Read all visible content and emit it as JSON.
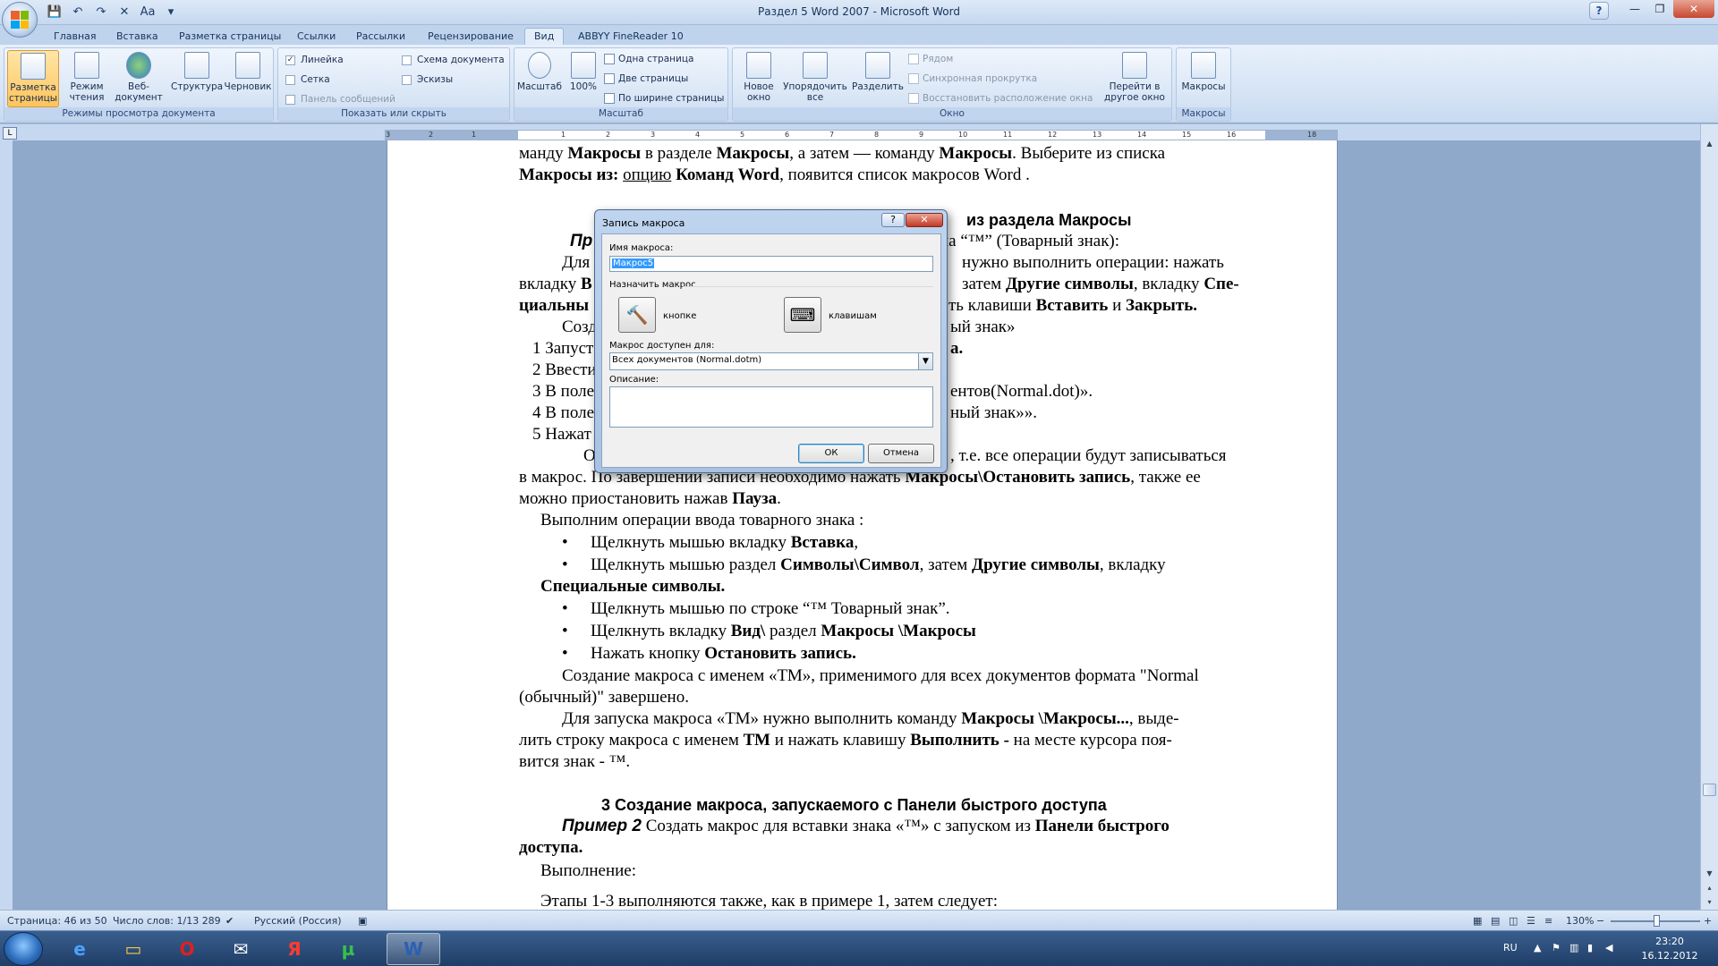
{
  "window": {
    "title": "Раздел 5 Word 2007 - Microsoft Word",
    "help_label": "?"
  },
  "tabs": [
    "Главная",
    "Вставка",
    "Разметка страницы",
    "Ссылки",
    "Рассылки",
    "Рецензирование",
    "Вид",
    "ABBYY FineReader 10"
  ],
  "active_tab": "Вид",
  "ribbon": {
    "views_group": {
      "label": "Режимы просмотра документа",
      "buttons": [
        "Разметка страницы",
        "Режим чтения",
        "Веб-документ",
        "Структура",
        "Черновик"
      ]
    },
    "show_group": {
      "label": "Показать или скрыть",
      "ruler": "Линейка",
      "grid": "Сетка",
      "message_bar": "Панель сообщений",
      "doc_map": "Схема документа",
      "thumbnails": "Эскизы"
    },
    "zoom_group": {
      "label": "Масштаб",
      "zoom": "Масштаб",
      "hundred": "100%",
      "one_page": "Одна страница",
      "two_pages": "Две страницы",
      "page_width": "По ширине страницы"
    },
    "window_group": {
      "label": "Окно",
      "new_window": "Новое окно",
      "arrange_all": "Упорядочить все",
      "split": "Разделить",
      "side_by_side": "Рядом",
      "sync_scroll": "Синхронная прокрутка",
      "reset_pos": "Восстановить расположение окна",
      "switch": "Перейти в другое окно"
    },
    "macros_group": {
      "label": "Макросы",
      "macros": "Макросы"
    }
  },
  "ruler_numbers": [
    "3",
    "2",
    "1",
    "1",
    "2",
    "3",
    "4",
    "5",
    "6",
    "7",
    "8",
    "9",
    "10",
    "11",
    "12",
    "13",
    "14",
    "15",
    "16",
    "18"
  ],
  "document": {
    "l1": "манду",
    "l1b": "Макросы",
    "l1c": "в разделе",
    "l1d": "Макросы",
    "l1e": ", а затем — команду",
    "l1f": "Макросы",
    "l1g": ". Выберите из списка",
    "l2a": "Макросы из:",
    "l2b": "опцию",
    "l2c": "Команд Word",
    "l2d": ", появится  список макросов Word .",
    "h1": "из раздела Макросы",
    "l3": "па “™” (Товарный знак):",
    "l4a": "Для",
    "l4b": "нужно выполнить операции: нажать",
    "l5a": "вкладку",
    "l5b": "В",
    "l5c": "затем",
    "l5d": "Другие символы",
    "l5e": ", вкладку",
    "l5f": "Спе-",
    "l6a": "циальны",
    "l6b": "ть клавиши",
    "l6c": "Вставить",
    "l6d": "и",
    "l6e": "Закрыть.",
    "l7a": "Созд",
    "l7b": "ый знак»",
    "l8a": "1 Запуст",
    "l8b": "а.",
    "l9a": "2 Ввести",
    "l10a": "3 В поле",
    "l10b": "ентов(Normal.dot)».",
    "l11a": "4 В поле",
    "l11b": "ный знак»».",
    "l12a": "5 Нажат",
    "l13a": "О",
    "l13b": ", т.е. все операции будут записываться",
    "l14a": "в макрос. По завершении записи необходимо нажать",
    "l14b": "Макросы\\Остановить запись",
    "l14c": ", также ее",
    "l15a": "можно приостановить нажав",
    "l15b": "Пауза",
    "l15c": ".",
    "l16": "Выполним операции ввода товарного знака :",
    "b1a": "Щелкнуть мышью вкладку",
    "b1b": "Вставка",
    "b1c": ",",
    "b2a": "Щелкнуть мышью раздел",
    "b2b": "Символы\\Символ",
    "b2c": ", затем",
    "b2d": "Другие символы",
    "b2e": ", вкладку",
    "b2f": "Специальные символы.",
    "b3": "Щелкнуть мышью по строке  “™     Товарный знак”.",
    "b4a": "Щелкнуть вкладку",
    "b4b": "Вид\\",
    "b4c": "раздел",
    "b4d": "Макросы \\Макросы",
    "b5a": "Нажать  кнопку",
    "b5b": "Остановить  запись.",
    "p1a": "Создание макроса с именем «ТМ», применимого для всех документов формата \"Normal",
    "p1b": "(обычный)\" завершено.",
    "p2a": "Для запуска макроса «ТМ» нужно выполнить команду",
    "p2b": "Макросы \\Макросы...",
    "p2c": ", выде-",
    "p2d": "лить строку  макроса с именем",
    "p2e": "ТМ",
    "p2f": "и нажать клавишу",
    "p2g": "Выполнить -",
    "p2h": "на месте курсора поя-",
    "p2i": "вится знак  - ™.",
    "h2": "3 Создание макроса, запускаемого  с Панели быстрого доступа",
    "ex_a": "Пример 2",
    "ex_b": " Создать макрос для вставки знака   «™»  с запуском из",
    "ex_c": "Панели быстрого",
    "ex_d": "доступа.",
    "exec": "Выполнение:",
    "steps": "Этапы  1-3  выполняются также, как в примере 1,  затем следует:",
    "pr_it": "Пр",
    "bullet": "•"
  },
  "dialog": {
    "title": "Запись макроса",
    "help": "?",
    "close": "✕",
    "name_label": "Имя макроса:",
    "name_value": "Макрос5",
    "assign_label": "Назначить макрос",
    "button_label": "кнопке",
    "keys_label": "клавишам",
    "store_label": "Макрос доступен для:",
    "store_value": "Всех документов (Normal.dotm)",
    "desc_label": "Описание:",
    "ok": "ОК",
    "cancel": "Отмена"
  },
  "status": {
    "page": "Страница: 46 из 50",
    "words": "Число слов: 1/13 289",
    "lang": "Русский (Россия)",
    "zoom": "130%",
    "minus": "−",
    "plus": "+"
  },
  "taskbar": {
    "lang": "RU",
    "time": "23:20",
    "date": "16.12.2012"
  },
  "colors": {
    "accent": "#ffc45c",
    "ribbon": "#d3e2f4",
    "taskbar": "#1f3d66"
  }
}
